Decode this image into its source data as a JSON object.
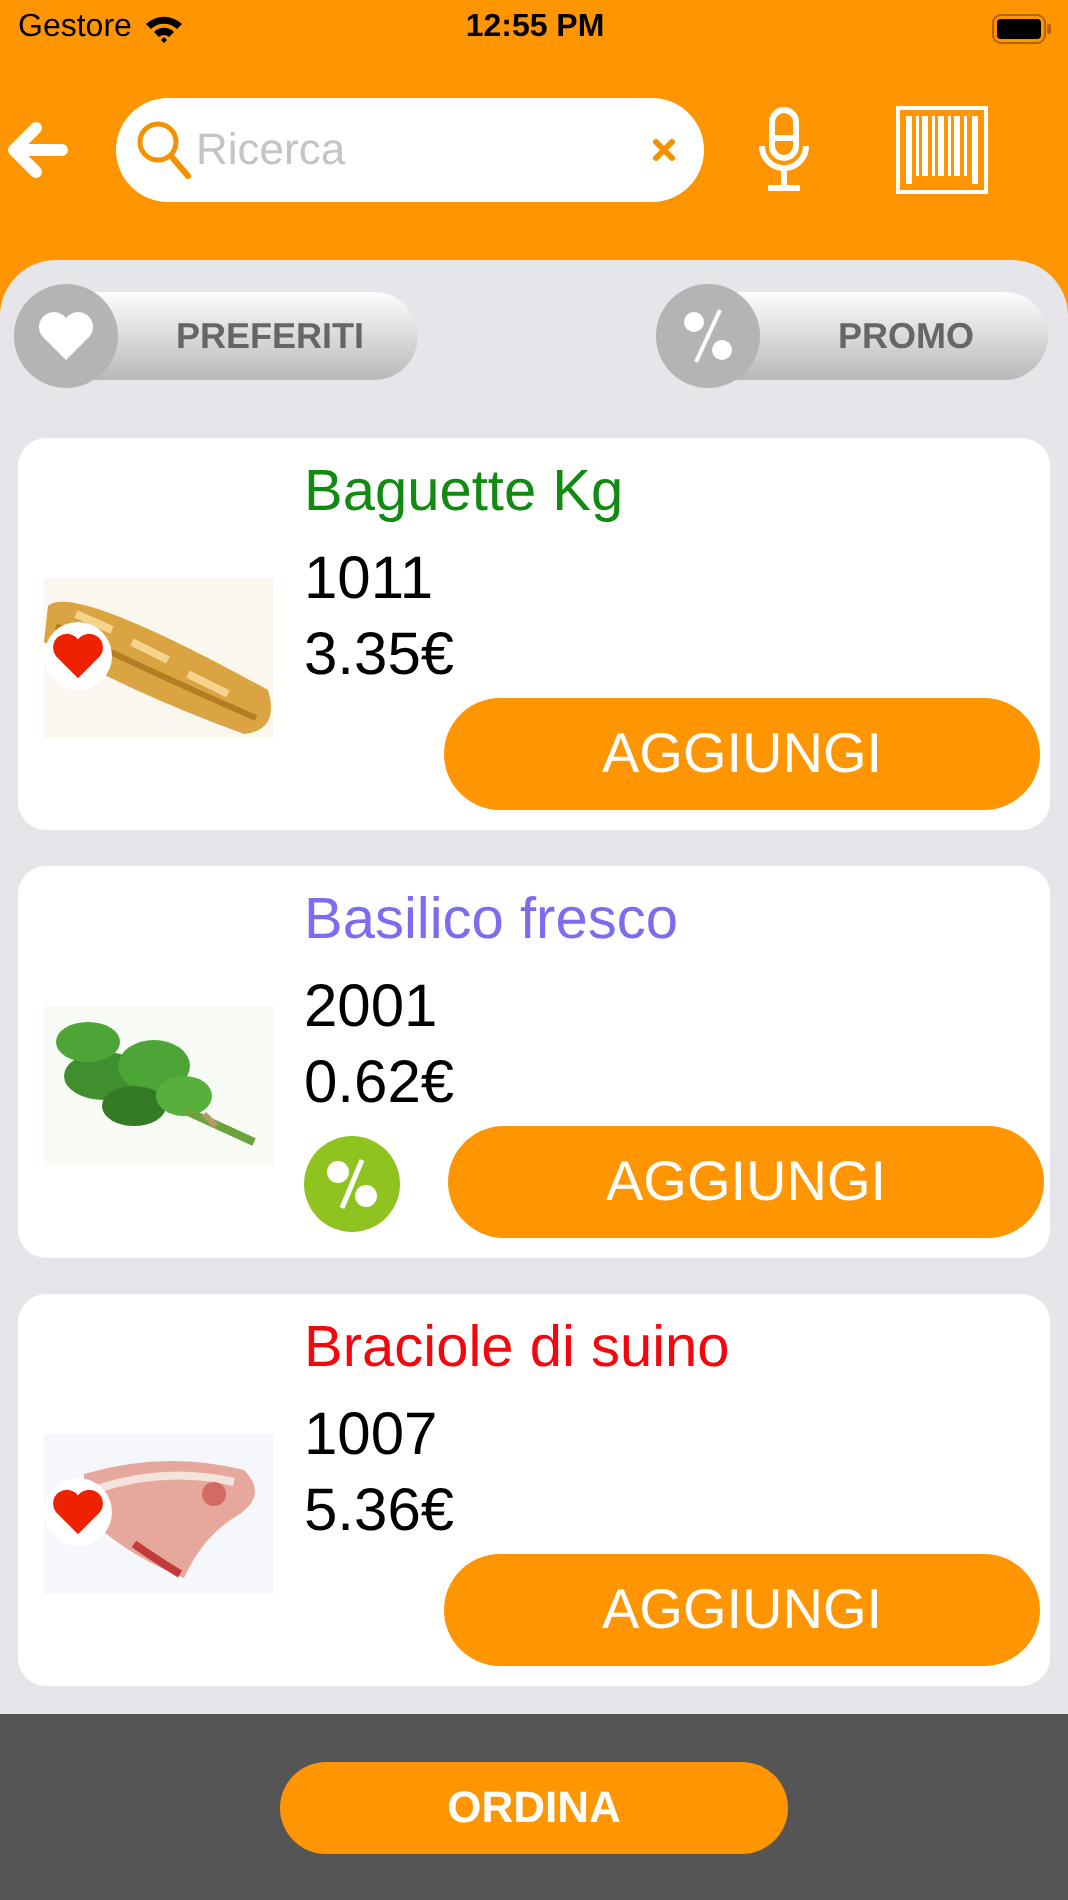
{
  "status_bar": {
    "carrier": "Gestore",
    "time": "12:55 PM"
  },
  "search": {
    "placeholder": "Ricerca"
  },
  "filters": [
    {
      "label": "PREFERITI",
      "kind": "favorites"
    },
    {
      "label": "PROMO",
      "kind": "promo"
    }
  ],
  "products": [
    {
      "name": "Baguette Kg",
      "color": "#118a11",
      "code": "1011",
      "price": "3.35€",
      "favorite": true,
      "promo": false,
      "button": "AGGIUNGI"
    },
    {
      "name": "Basilico fresco",
      "color": "#7b6cf0",
      "code": "2001",
      "price": "0.62€",
      "favorite": false,
      "promo": true,
      "button": "AGGIUNGI"
    },
    {
      "name": "Braciole di suino",
      "color": "#f4060f",
      "code": "1007",
      "price": "5.36€",
      "favorite": true,
      "promo": false,
      "button": "AGGIUNGI"
    }
  ],
  "order_button": "ORDINA"
}
